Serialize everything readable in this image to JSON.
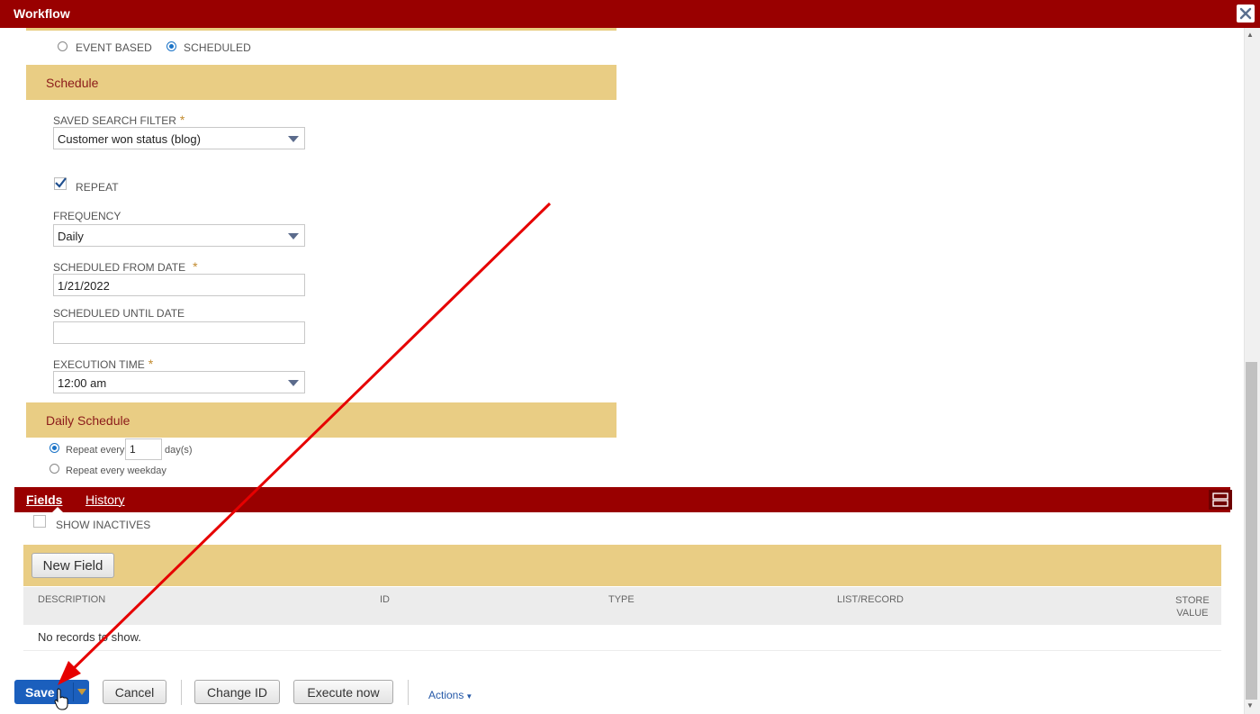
{
  "window": {
    "title": "Workflow",
    "close_icon": "close-icon"
  },
  "trigger": {
    "options": [
      {
        "label": "EVENT BASED",
        "selected": false
      },
      {
        "label": "SCHEDULED",
        "selected": true
      }
    ]
  },
  "schedule": {
    "title": "Schedule",
    "saved_search_filter": {
      "label": "SAVED SEARCH FILTER",
      "required_mark": "*",
      "value": "Customer won status (blog)"
    },
    "repeat": {
      "label": "REPEAT",
      "checked": true
    },
    "frequency": {
      "label": "FREQUENCY",
      "value": "Daily"
    },
    "scheduled_from_date": {
      "label": "SCHEDULED FROM DATE",
      "required_mark": "*",
      "value": "1/21/2022"
    },
    "scheduled_until_date": {
      "label": "SCHEDULED UNTIL DATE",
      "value": ""
    },
    "execution_time": {
      "label": "EXECUTION TIME",
      "required_mark": "*",
      "value": "12:00 am"
    }
  },
  "daily_schedule": {
    "title": "Daily Schedule",
    "repeat_every": {
      "label": "Repeat every",
      "value": "1",
      "unit": "day(s)",
      "selected": true
    },
    "repeat_weekday": {
      "label": "Repeat every weekday",
      "selected": false
    }
  },
  "tabs": [
    {
      "label": "Fields",
      "active": true
    },
    {
      "label": "History",
      "active": false
    }
  ],
  "fields": {
    "show_inactives": {
      "label": "SHOW INACTIVES",
      "checked": false
    },
    "new_field_button": "New Field",
    "columns": [
      "DESCRIPTION",
      "ID",
      "TYPE",
      "LIST/RECORD",
      "STORE VALUE"
    ],
    "store_value_lines": [
      "STORE",
      "VALUE"
    ],
    "empty_message": "No records to show."
  },
  "footer": {
    "save": "Save",
    "cancel": "Cancel",
    "change_id": "Change ID",
    "execute_now": "Execute now",
    "actions": "Actions"
  },
  "colors": {
    "titlebar": "#990000",
    "section": "#e9cd84",
    "primary_button": "#1b5fbd",
    "annotation_arrow": "#e60000"
  }
}
